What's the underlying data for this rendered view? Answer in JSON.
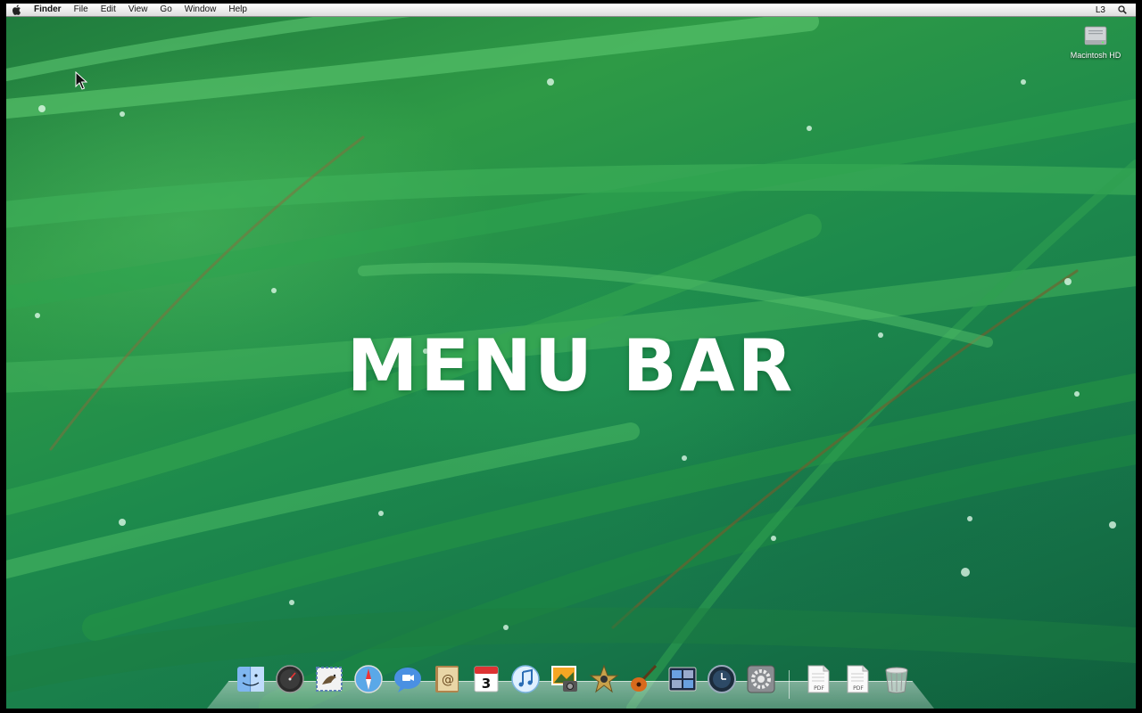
{
  "menubar": {
    "apple_icon": "apple-icon",
    "items": [
      "Finder",
      "File",
      "Edit",
      "View",
      "Go",
      "Window",
      "Help"
    ],
    "right_status": "L3",
    "spotlight_icon": "spotlight-icon"
  },
  "desktop": {
    "hard_drive_label": "Macintosh HD",
    "title_overlay": "MENU BAR"
  },
  "dock": {
    "apps": [
      {
        "icon": "finder-icon"
      },
      {
        "icon": "dashboard-icon"
      },
      {
        "icon": "mail-icon"
      },
      {
        "icon": "safari-icon"
      },
      {
        "icon": "ichat-icon"
      },
      {
        "icon": "address-book-icon"
      },
      {
        "icon": "ical-icon",
        "date": "3"
      },
      {
        "icon": "itunes-icon"
      },
      {
        "icon": "iphoto-icon"
      },
      {
        "icon": "imovie-icon"
      },
      {
        "icon": "garageband-icon"
      },
      {
        "icon": "spaces-icon"
      },
      {
        "icon": "time-machine-icon"
      },
      {
        "icon": "system-preferences-icon"
      }
    ],
    "documents": [
      {
        "icon": "pdf-document-icon",
        "label": "PDF"
      },
      {
        "icon": "pdf-document-icon",
        "label": "PDF"
      }
    ],
    "trash_icon": "trash-icon"
  },
  "colors": {
    "grass_dark": "#0f5e3c",
    "grass_light": "#2e9a46",
    "menubar_bg": "#e8e8e8",
    "title_text": "#ffffff"
  }
}
